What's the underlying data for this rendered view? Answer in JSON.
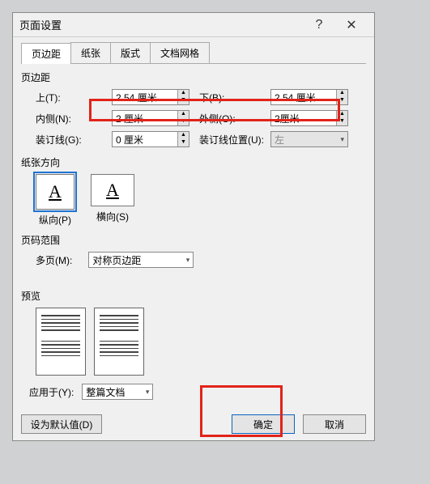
{
  "window": {
    "title": "页面设置"
  },
  "tabs": {
    "margins": "页边距",
    "paper": "纸张",
    "layout": "版式",
    "docgrid": "文档网格"
  },
  "margins": {
    "section": "页边距",
    "top_label": "上(T):",
    "top_value": "2.54 厘米",
    "bottom_label": "下(B):",
    "bottom_value": "2.54 厘米",
    "inner_label": "内侧(N):",
    "inner_value": "2 厘米",
    "outer_label": "外侧(O):",
    "outer_value": "2厘米",
    "gutter_label": "装订线(G):",
    "gutter_value": "0 厘米",
    "gutterpos_label": "装订线位置(U):",
    "gutterpos_value": "左"
  },
  "orientation": {
    "section": "纸张方向",
    "portrait": "纵向(P)",
    "landscape": "横向(S)"
  },
  "pagerange": {
    "section": "页码范围",
    "multipage_label": "多页(M):",
    "multipage_value": "对称页边距"
  },
  "preview": {
    "section": "预览"
  },
  "apply": {
    "label": "应用于(Y):",
    "value": "整篇文档"
  },
  "footer": {
    "default": "设为默认值(D)",
    "ok": "确定",
    "cancel": "取消"
  }
}
